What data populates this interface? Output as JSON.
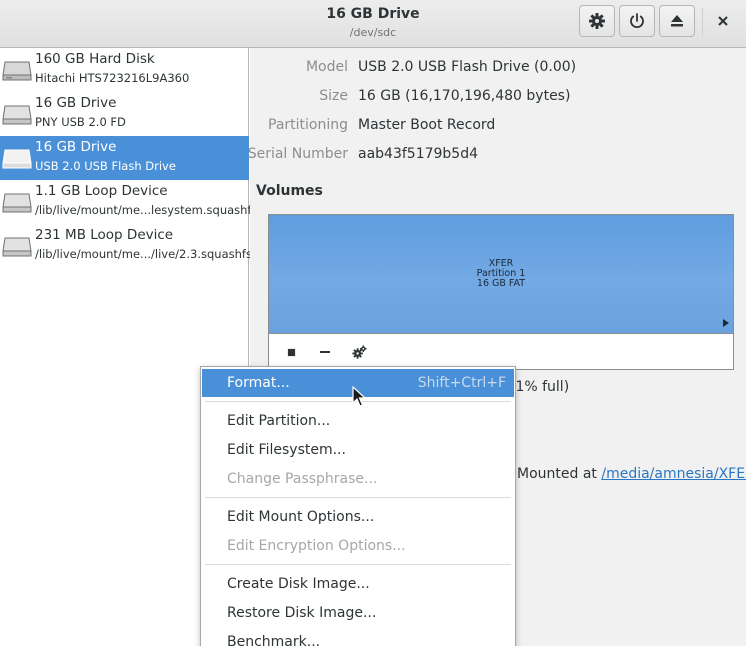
{
  "header": {
    "title": "16 GB Drive",
    "subtitle": "/dev/sdc",
    "buttons": [
      {
        "name": "gear-button",
        "icon": "gear-icon"
      },
      {
        "name": "power-off-button",
        "icon": "power-icon"
      },
      {
        "name": "eject-button",
        "icon": "eject-icon"
      }
    ],
    "close_icon": "close-icon"
  },
  "sidebar": {
    "items": [
      {
        "name": "160 GB Hard Disk",
        "sub": "Hitachi HTS723216L9A360",
        "selected": false
      },
      {
        "name": "16 GB Drive",
        "sub": "PNY USB 2.0 FD",
        "selected": false
      },
      {
        "name": "16 GB Drive",
        "sub": "USB 2.0 USB Flash Drive",
        "selected": true
      },
      {
        "name": "1.1 GB Loop Device",
        "sub": "/lib/live/mount/me...lesystem.squashfs",
        "selected": false
      },
      {
        "name": "231 MB Loop Device",
        "sub": "/lib/live/mount/me.../live/2.3.squashfs",
        "selected": false
      }
    ]
  },
  "properties": [
    {
      "label": "Model",
      "value": "USB 2.0 USB Flash Drive (0.00)"
    },
    {
      "label": "Size",
      "value": "16 GB (16,170,196,480 bytes)"
    },
    {
      "label": "Partitioning",
      "value": "Master Boot Record"
    },
    {
      "label": "Serial Number",
      "value": "aab43f5179b5d4"
    }
  ],
  "volumes": {
    "title": "Volumes",
    "partition": {
      "line1": "XFER",
      "line2": "Partition 1",
      "line3": "16 GB FAT"
    },
    "toolbar": [
      "stop-icon",
      "minus-icon",
      "gears-icon"
    ]
  },
  "background_text": {
    "size_fragment": ".1% full)",
    "mounted_prefix": "Mounted at ",
    "mounted_link": "/media/amnesia/XFER"
  },
  "menu": {
    "items": [
      {
        "label": "Format...",
        "accel": "Shift+Ctrl+F",
        "highlighted": true,
        "disabled": false
      },
      {
        "label": "Edit Partition...",
        "accel": "",
        "highlighted": false,
        "disabled": false
      },
      {
        "label": "Edit Filesystem...",
        "accel": "",
        "highlighted": false,
        "disabled": false
      },
      {
        "label": "Change Passphrase...",
        "accel": "",
        "highlighted": false,
        "disabled": true
      },
      {
        "label": "Edit Mount Options...",
        "accel": "",
        "highlighted": false,
        "disabled": false
      },
      {
        "label": "Edit Encryption Options...",
        "accel": "",
        "highlighted": false,
        "disabled": true
      },
      {
        "label": "Create Disk Image...",
        "accel": "",
        "highlighted": false,
        "disabled": false
      },
      {
        "label": "Restore Disk Image...",
        "accel": "",
        "highlighted": false,
        "disabled": false
      },
      {
        "label": "Benchmark...",
        "accel": "",
        "highlighted": false,
        "disabled": false
      }
    ]
  },
  "colors": {
    "accent": "#4a90d9",
    "link": "#2a76c6"
  }
}
